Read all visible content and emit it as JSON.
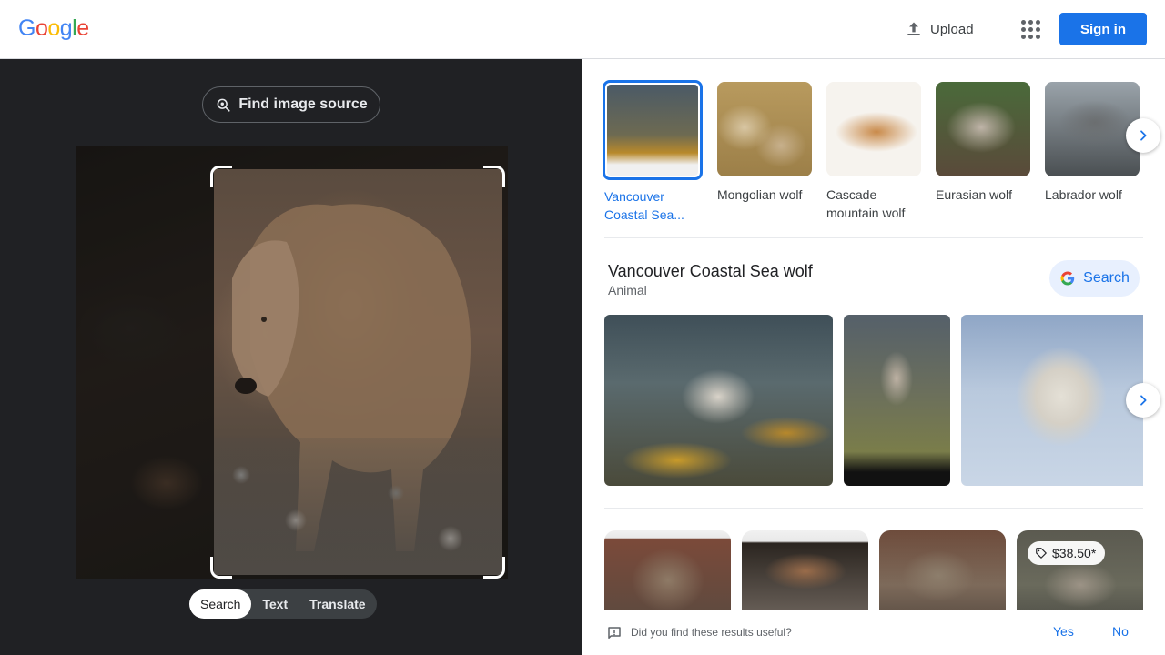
{
  "header": {
    "logo_letters": [
      "G",
      "o",
      "o",
      "g",
      "l",
      "e"
    ],
    "logo_colors": [
      "#4285f4",
      "#ea4335",
      "#fbbc05",
      "#4285f4",
      "#34a853",
      "#ea4335"
    ],
    "upload_label": "Upload",
    "apps_icon": "apps-grid-icon",
    "signin_label": "Sign in"
  },
  "left_panel": {
    "find_source_label": "Find image source",
    "mode_tabs": [
      {
        "label": "Search",
        "active": true
      },
      {
        "label": "Text",
        "active": false
      },
      {
        "label": "Translate",
        "active": false
      }
    ]
  },
  "related": [
    {
      "label": "Vancouver Coastal Sea...",
      "selected": true
    },
    {
      "label": "Mongolian wolf",
      "selected": false
    },
    {
      "label": "Cascade mountain wolf",
      "selected": false
    },
    {
      "label": "Eurasian wolf",
      "selected": false
    },
    {
      "label": "Labrador wolf",
      "selected": false
    }
  ],
  "entity": {
    "title": "Vancouver Coastal Sea wolf",
    "subtitle": "Animal",
    "search_label": "Search"
  },
  "results": {
    "price_badge": "$38.50*"
  },
  "feedback": {
    "question": "Did you find these results useful?",
    "yes_label": "Yes",
    "no_label": "No"
  },
  "colors": {
    "accent": "#1a73e8",
    "dark_panel": "#202124"
  }
}
